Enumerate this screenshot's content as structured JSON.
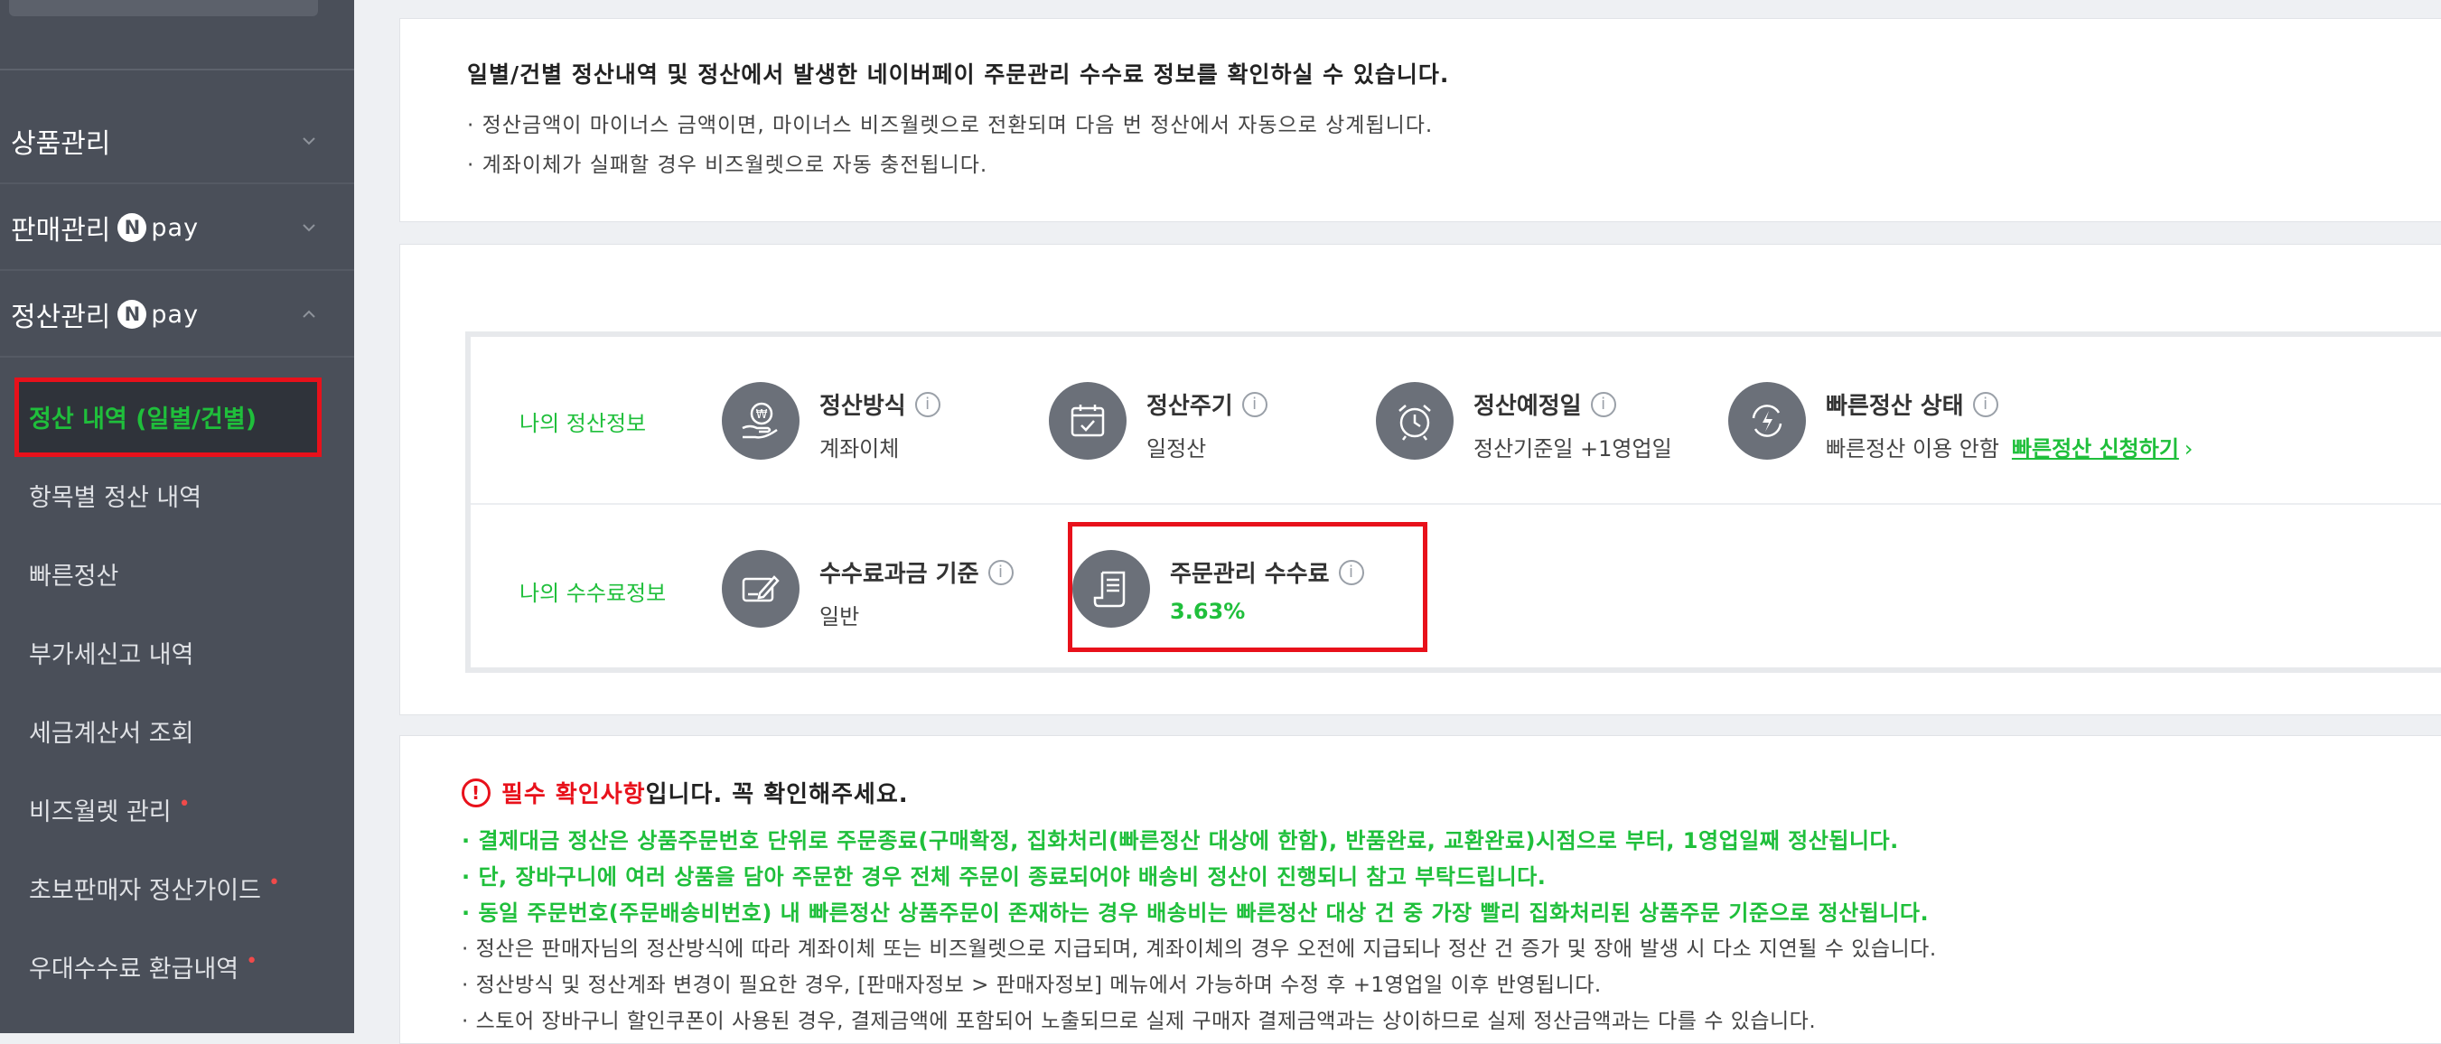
{
  "sidebar": {
    "menus": [
      {
        "label": "상품관리",
        "npay": false,
        "expanded": false
      },
      {
        "label": "판매관리",
        "npay": true,
        "expanded": false
      },
      {
        "label": "정산관리",
        "npay": true,
        "expanded": true
      }
    ],
    "npay_n": "N",
    "npay_text": "pay",
    "submenu": [
      {
        "label": "정산 내역 (일별/건별)",
        "active": true,
        "dot": false
      },
      {
        "label": "항목별 정산 내역",
        "active": false,
        "dot": false
      },
      {
        "label": "빠른정산",
        "active": false,
        "dot": false
      },
      {
        "label": "부가세신고 내역",
        "active": false,
        "dot": false
      },
      {
        "label": "세금계산서 조회",
        "active": false,
        "dot": false
      },
      {
        "label": "비즈월렛 관리",
        "active": false,
        "dot": true
      },
      {
        "label": "초보판매자 정산가이드",
        "active": false,
        "dot": true
      },
      {
        "label": "우대수수료 환급내역",
        "active": false,
        "dot": true
      }
    ],
    "dot_glyph": "•"
  },
  "intro": {
    "title": "일별/건별 정산내역 및 정산에서 발생한 네이버페이 주문관리 수수료 정보를 확인하실 수 있습니다.",
    "lines": [
      "· 정산금액이 마이너스 금액이면, 마이너스 비즈월렛으로 전환되며 다음 번 정산에서 자동으로 상계됩니다.",
      "· 계좌이체가 실패할 경우 비즈월렛으로 자동 충전됩니다."
    ]
  },
  "settlement_info": {
    "label": "나의 정산정보",
    "items": [
      {
        "title": "정산방식",
        "value": "계좌이체",
        "icon": "hand-coin-icon"
      },
      {
        "title": "정산주기",
        "value": "일정산",
        "icon": "calendar-icon"
      },
      {
        "title": "정산예정일",
        "value": "정산기준일 +1영업일",
        "icon": "alarm-clock-icon"
      },
      {
        "title": "빠른정산 상태",
        "value": "빠른정산 이용 안함",
        "icon": "lightning-icon",
        "link": "빠른정산 신청하기",
        "link_chevron": "›"
      }
    ]
  },
  "fee_info": {
    "label": "나의 수수료정보",
    "items": [
      {
        "title": "수수료과금 기준",
        "value": "일반",
        "icon": "card-pen-icon"
      },
      {
        "title": "주문관리 수수료",
        "value": "3.63%",
        "icon": "receipt-icon"
      }
    ]
  },
  "info_glyph": "i",
  "notice": {
    "warn_glyph": "!",
    "required": "필수 확인사항",
    "head_rest": "입니다. 꼭 확인해주세요.",
    "green_bullets": [
      "· 결제대금 정산은 상품주문번호 단위로 주문종료(구매확정, 집화처리(빠른정산 대상에 한함), 반품완료, 교환완료)시점으로 부터, 1영업일째 정산됩니다.",
      "· 단, 장바구니에 여러 상품을 담아 주문한 경우 전체 주문이 종료되어야 배송비 정산이 진행되니 참고 부탁드립니다.",
      "· 동일 주문번호(주문배송비번호) 내 빠른정산 상품주문이 존재하는 경우 배송비는 빠른정산 대상 건 중 가장 빨리 집화처리된 상품주문 기준으로 정산됩니다."
    ],
    "bullets": [
      "· 정산은 판매자님의 정산방식에 따라 계좌이체 또는 비즈월렛으로 지급되며, 계좌이체의 경우 오전에 지급되나 정산 건 증가 및 장애 발생 시 다소 지연될 수 있습니다.",
      "· 정산방식 및 정산계좌 변경이 필요한 경우, [판매자정보 > 판매자정보] 메뉴에서 가능하며 수정 후 +1영업일 이후 반영됩니다.",
      "· 스토어 장바구니 할인쿠폰이 사용된 경우, 결제금액에 포함되어 노출되므로 실제 구매자 결제금액과는 상이하므로 실제 정산금액과는 다를 수 있습니다."
    ]
  },
  "colors": {
    "sidebar_bg": "#4a4f59",
    "accent_green": "#1fbf3b",
    "highlight_red": "#e8111b",
    "icon_gray": "#6b7079"
  }
}
